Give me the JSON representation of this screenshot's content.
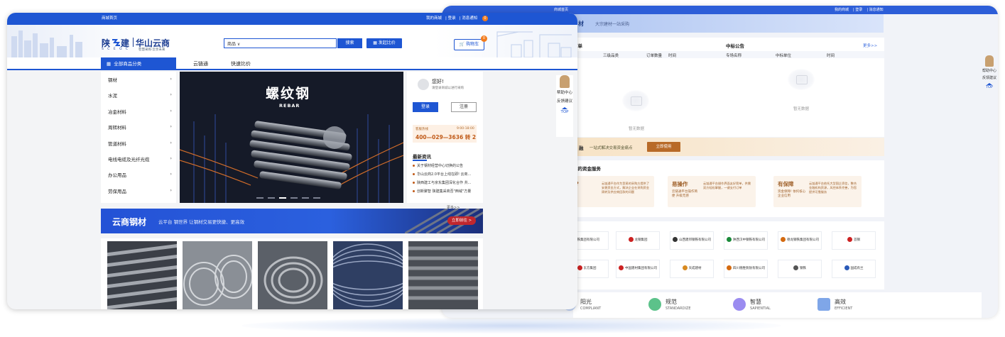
{
  "back_window": {
    "topbar": {
      "left": "商城首页",
      "links": [
        "我的商城",
        "登录",
        "消息通知"
      ]
    },
    "hero": {
      "title_partial": "材",
      "slogan": "大宗建材一站采购"
    },
    "orders_panel": {
      "title_partial": "订单",
      "columns": [
        "三级品类",
        "订单数量",
        "时间"
      ],
      "empty_text": "暂无数据"
    },
    "bids_panel": {
      "title": "中标公告",
      "more": "更多>>",
      "columns": [
        "专场名称",
        "中标单位",
        "时间"
      ],
      "empty_text": "暂无数据"
    },
    "finance_banner": {
      "label_partial": "融",
      "text": "一站式解决交易资金痛点",
      "button": "立即使用"
    },
    "fund_services": {
      "title_partial": "样的资金服务",
      "cards": [
        {
          "title_partial": "买?",
          "desc": "",
          "detail": "云链通平台作为贸易的采购方提供了安稳资金方式，解决企业在采购资金周转及供应商回款的问题"
        },
        {
          "title": "易操作",
          "desc": "云链通平台操作简便 升级无感",
          "detail": "云链通平台操作界面友好简单，供需双方轻松掌握，一键支付订单"
        },
        {
          "title": "有保障",
          "desc": "资金保障! 依托核心企业信用",
          "detail": "云链通平台依托大型国企资信，整合金融机构资源，风控体系完善，为您提供可靠服务"
        }
      ]
    },
    "partners": [
      [
        "钢铁集团有限公司",
        "龙钢集团",
        "山西建邦钢铁有限公司",
        "陕西汉中钢铁有限公司",
        "德龙钢铁集团有限公司",
        "首钢"
      ],
      [
        "东方集团",
        "中国建材集团有限公司",
        "天成建材",
        "四川德胜钒钛有限公司",
        "钢铁",
        "国成有兰"
      ]
    ],
    "features": [
      {
        "name": "阳光",
        "en": "COMPLIANT",
        "color": "#8fb1f0"
      },
      {
        "name": "规范",
        "en": "STANDARDIZE",
        "color": "#5cc28a"
      },
      {
        "name": "智慧",
        "en": "SAPIENTIAL",
        "color": "#9b8cf0"
      },
      {
        "name": "高效",
        "en": "EFFICIENT",
        "color": "#7fa6e8"
      }
    ],
    "help": {
      "help": "帮助中心",
      "feedback": "反馈建议",
      "top": "TOP"
    }
  },
  "front_window": {
    "topbar": {
      "left": "商城首页",
      "links": [
        "我的商城",
        "登录",
        "消息通知"
      ],
      "badge": "0"
    },
    "brand": {
      "name1": "陕",
      "name2": "建",
      "name3": "华山云商",
      "sub_en": "S C E G C",
      "sub_cn": "智慧采购·云享未来"
    },
    "search": {
      "category": "商品 ∨",
      "button": "搜索",
      "compare": "发起比价"
    },
    "cart": {
      "label": "购物车",
      "count": "0"
    },
    "nav": {
      "all_categories": "全部商品分类",
      "links": [
        "云链通",
        "快速比价"
      ]
    },
    "categories": [
      "钢材",
      "水泥",
      "冶金材料",
      "周转材料",
      "管道材料",
      "电线电缆及光纤光缆",
      "办公用品",
      "劳保用品"
    ],
    "main_banner": {
      "title": "螺纹钢",
      "subtitle": "REBAR"
    },
    "user_panel": {
      "greeting": "您好!",
      "hint": "请登录商城以进行采购",
      "login": "登录",
      "register": "注册",
      "hotline_label": "客服热线",
      "hotline_hours": "9:00-18:00",
      "hotline_number": "400—029—3636 转 2",
      "news_title": "最新资讯",
      "news": [
        "关于钢材经营中心切换的公告",
        "华山云商2.0平台上线在即! 云商...",
        "陕西建工与京东集团深化合作 共...",
        "创新聚智 陕建集采商否\"西域\"方量"
      ],
      "more": "更多>>"
    },
    "help": {
      "help": "帮助中心",
      "feedback": "反馈建议",
      "top": "TOP"
    },
    "steel_banner": {
      "title": "云商钢材",
      "slogan": "云平台 钢世界 让钢材交易更快捷、更高效",
      "button": "立即前往 >"
    }
  },
  "colors": {
    "brand_blue": "#1e56d3",
    "accent_orange": "#f27b1c",
    "brand_navy": "#1e3f93"
  }
}
